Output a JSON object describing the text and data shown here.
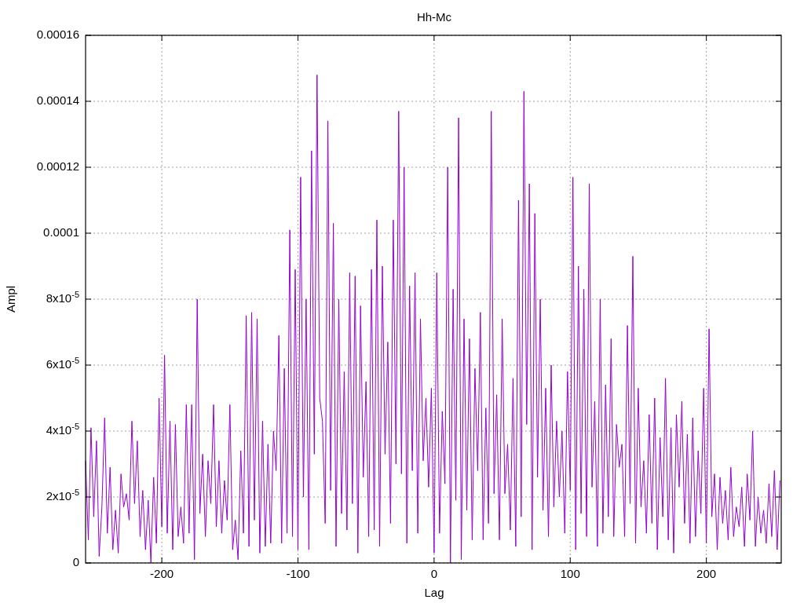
{
  "chart_data": {
    "type": "line",
    "title": "Hh-Mc",
    "xlabel": "Lag",
    "ylabel": "Ampl",
    "xlim": [
      -256,
      255
    ],
    "ylim": [
      0,
      0.00016
    ],
    "xticks": [
      -200,
      -100,
      0,
      100,
      200
    ],
    "yticks": [
      0,
      {
        "value": 2e-05,
        "label": "2x10$^{-5}$"
      },
      {
        "value": 4e-05,
        "label": "4x10$^{-5}$"
      },
      {
        "value": 6e-05,
        "label": "6x10$^{-5}$"
      },
      {
        "value": 8e-05,
        "label": "8x10$^{-5}$"
      },
      0.0001,
      0.00012,
      0.00014,
      0.00016
    ],
    "x": [
      -256,
      -254,
      -252,
      -250,
      -248,
      -246,
      -244,
      -242,
      -240,
      -238,
      -236,
      -234,
      -232,
      -230,
      -228,
      -226,
      -224,
      -222,
      -220,
      -218,
      -216,
      -214,
      -212,
      -210,
      -208,
      -206,
      -204,
      -202,
      -200,
      -198,
      -196,
      -194,
      -192,
      -190,
      -188,
      -186,
      -184,
      -182,
      -180,
      -178,
      -176,
      -174,
      -172,
      -170,
      -168,
      -166,
      -164,
      -162,
      -160,
      -158,
      -156,
      -154,
      -152,
      -150,
      -148,
      -146,
      -144,
      -142,
      -140,
      -138,
      -136,
      -134,
      -132,
      -130,
      -128,
      -126,
      -124,
      -122,
      -120,
      -118,
      -116,
      -114,
      -112,
      -110,
      -108,
      -106,
      -104,
      -102,
      -100,
      -98,
      -96,
      -94,
      -92,
      -90,
      -88,
      -86,
      -84,
      -82,
      -80,
      -78,
      -76,
      -74,
      -72,
      -70,
      -68,
      -66,
      -64,
      -62,
      -60,
      -58,
      -56,
      -54,
      -52,
      -50,
      -48,
      -46,
      -44,
      -42,
      -40,
      -38,
      -36,
      -34,
      -32,
      -30,
      -28,
      -26,
      -24,
      -22,
      -20,
      -18,
      -16,
      -14,
      -12,
      -10,
      -8,
      -6,
      -4,
      -2,
      0,
      2,
      4,
      6,
      8,
      10,
      12,
      14,
      16,
      18,
      20,
      22,
      24,
      26,
      28,
      30,
      32,
      34,
      36,
      38,
      40,
      42,
      44,
      46,
      48,
      50,
      52,
      54,
      56,
      58,
      60,
      62,
      64,
      66,
      68,
      70,
      72,
      74,
      76,
      78,
      80,
      82,
      84,
      86,
      88,
      90,
      92,
      94,
      96,
      98,
      100,
      102,
      104,
      106,
      108,
      110,
      112,
      114,
      116,
      118,
      120,
      122,
      124,
      126,
      128,
      130,
      132,
      134,
      136,
      138,
      140,
      142,
      144,
      146,
      148,
      150,
      152,
      154,
      156,
      158,
      160,
      162,
      164,
      166,
      168,
      170,
      172,
      174,
      176,
      178,
      180,
      182,
      184,
      186,
      188,
      190,
      192,
      194,
      196,
      198,
      200,
      202,
      204,
      206,
      208,
      210,
      212,
      214,
      216,
      218,
      220,
      222,
      224,
      226,
      228,
      230,
      232,
      234,
      236,
      238,
      240,
      242,
      244,
      246,
      248,
      250,
      252,
      254
    ],
    "grid": true,
    "series": [
      {
        "color": "#9400d3",
        "values": [
          3.1e-05,
          7e-06,
          4.1e-05,
          1.4e-05,
          3.7e-05,
          2e-06,
          1.7e-05,
          4.4e-05,
          9e-06,
          2.9e-05,
          4e-06,
          1.6e-05,
          3e-06,
          2.7e-05,
          1.7e-05,
          2.1e-05,
          1.3e-05,
          4.3e-05,
          1.8e-05,
          3.7e-05,
          8e-06,
          2.2e-05,
          4e-06,
          1.9e-05,
          0.0,
          2.6e-05,
          6e-06,
          5e-05,
          1.1e-05,
          6.3e-05,
          9e-06,
          4.3e-05,
          4e-06,
          4.2e-05,
          8e-06,
          1.7e-05,
          6e-06,
          4.8e-05,
          9e-06,
          4.8e-05,
          1e-06,
          8e-05,
          1.5e-05,
          3.3e-05,
          8e-06,
          3.1e-05,
          1.8e-05,
          4.8e-05,
          1.1e-05,
          3.1e-05,
          9e-06,
          2.5e-05,
          1.3e-05,
          4.8e-05,
          4e-06,
          1.3e-05,
          1e-06,
          3.4e-05,
          9e-06,
          7.5e-05,
          5e-06,
          7.6e-05,
          1.3e-05,
          7.4e-05,
          3e-06,
          4.3e-05,
          5e-06,
          3.6e-05,
          6e-06,
          4e-05,
          2.8e-05,
          6.9e-05,
          6e-06,
          5.9e-05,
          9e-06,
          0.000101,
          8e-06,
          8.9e-05,
          4e-06,
          0.000117,
          2e-05,
          8e-05,
          4e-06,
          0.000125,
          3.3e-05,
          0.000148,
          5e-05,
          4.3e-05,
          1.2e-05,
          0.000134,
          2.2e-05,
          0.000103,
          5e-06,
          8e-05,
          1.5e-05,
          5.8e-05,
          1e-05,
          8.8e-05,
          1.8e-05,
          8.7e-05,
          3e-06,
          7.8e-05,
          2.6e-05,
          5.5e-05,
          8e-06,
          8.9e-05,
          1e-05,
          0.000104,
          5e-06,
          9e-05,
          3.3e-05,
          6.7e-05,
          1.2e-05,
          0.000104,
          3e-05,
          0.000137,
          2.7e-05,
          0.00012,
          6e-06,
          8.4e-05,
          2.8e-05,
          8.8e-05,
          9e-06,
          7.4e-05,
          3.1e-05,
          5e-05,
          2.3e-05,
          5.3e-05,
          3e-06,
          8.8e-05,
          9e-06,
          4.6e-05,
          2.4e-05,
          0.00012,
          0.0,
          8.3e-05,
          1.9e-05,
          0.000135,
          1e-06,
          7.4e-05,
          1.6e-05,
          6.8e-05,
          7e-06,
          5.9e-05,
          2.8e-05,
          7.6e-05,
          7e-06,
          4.7e-05,
          1.2e-05,
          0.000137,
          2.1e-05,
          5.1e-05,
          7e-06,
          7.4e-05,
          2.1e-05,
          3.6e-05,
          1e-05,
          5.6e-05,
          5e-06,
          0.00011,
          1.4e-05,
          0.000143,
          4.2e-05,
          0.000115,
          4e-06,
          0.000106,
          2.6e-05,
          8e-05,
          1.6e-05,
          5.3e-05,
          8e-06,
          6e-05,
          1.7e-05,
          4.3e-05,
          2e-05,
          4e-05,
          9e-06,
          5.8e-05,
          2.2e-05,
          0.000117,
          4e-06,
          9e-05,
          1.5e-05,
          8.3e-05,
          8e-06,
          0.000115,
          2.3e-05,
          4.9e-05,
          5e-06,
          8e-05,
          9e-06,
          5.4e-05,
          1.4e-05,
          6.8e-05,
          8e-06,
          4.2e-05,
          2.9e-05,
          3.6e-05,
          8e-06,
          7.2e-05,
          1.8e-05,
          9.3e-05,
          6e-06,
          5.3e-05,
          1.7e-05,
          3.1e-05,
          9e-06,
          4.5e-05,
          1.2e-05,
          5e-05,
          4e-06,
          3.8e-05,
          1.4e-05,
          5.6e-05,
          7e-06,
          4.1e-05,
          3e-06,
          4.5e-05,
          2.3e-05,
          4.9e-05,
          1.2e-05,
          3.9e-05,
          6e-06,
          4.4e-05,
          8e-06,
          3.4e-05,
          1.5e-05,
          5.3e-05,
          6e-06,
          7.1e-05,
          1.4e-05,
          2.7e-05,
          4e-06,
          2.6e-05,
          1.2e-05,
          2.2e-05,
          7e-06,
          2.9e-05,
          8e-06,
          1.7e-05,
          1.1e-05,
          2.3e-05,
          5e-06,
          2.7e-05,
          1.3e-05,
          4e-05,
          5e-06,
          2e-05,
          9e-06,
          1.6e-05,
          6e-06,
          2.4e-05,
          8e-06,
          2.8e-05,
          4e-06,
          2.5e-05
        ]
      }
    ]
  }
}
